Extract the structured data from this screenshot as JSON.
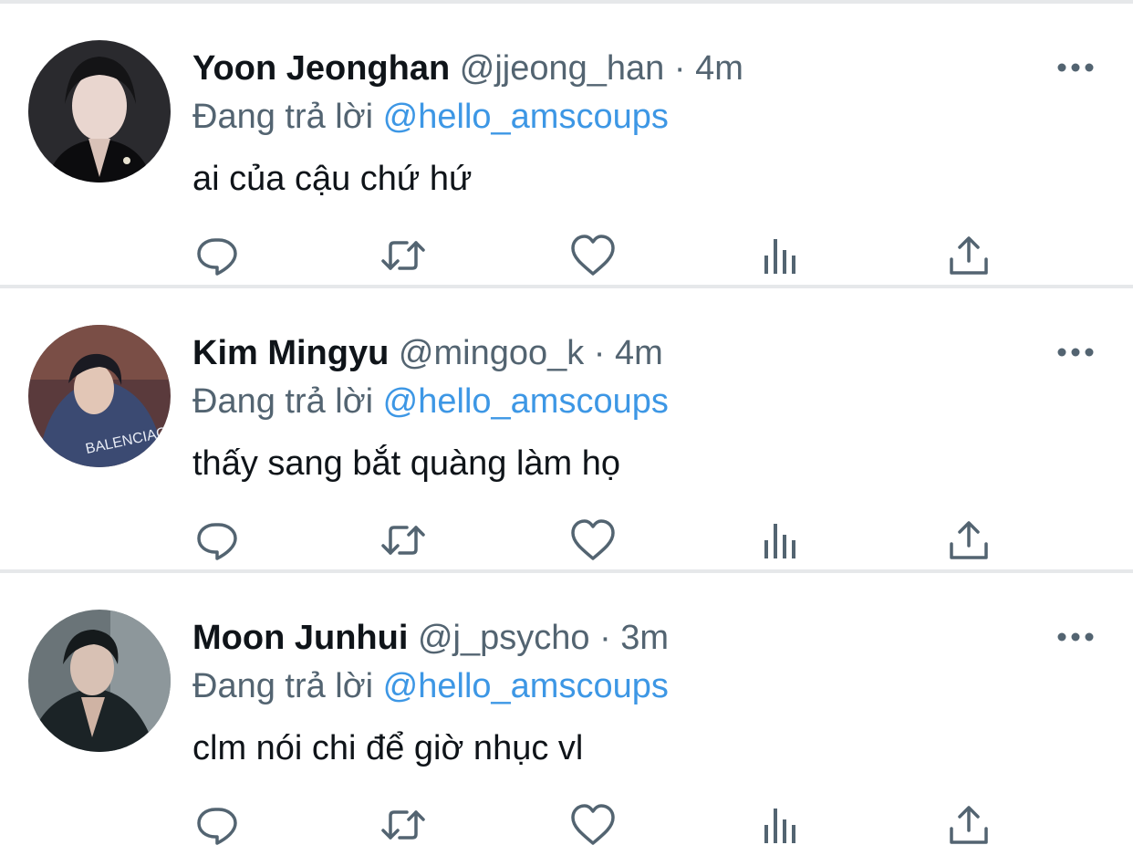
{
  "tweets": [
    {
      "name": "Yoon Jeonghan",
      "handle": "@jjeong_han",
      "separator": "·",
      "time": "4m",
      "reply_prefix": "Đang trả lời",
      "reply_to": "@hello_amscoups",
      "text": "ai của cậu chứ hứ"
    },
    {
      "name": "Kim Mingyu",
      "handle": "@mingoo_k",
      "separator": "·",
      "time": "4m",
      "reply_prefix": "Đang trả lời",
      "reply_to": "@hello_amscoups",
      "text": "thấy sang bắt quàng làm họ"
    },
    {
      "name": "Moon Junhui",
      "handle": "@j_psycho",
      "separator": "·",
      "time": "3m",
      "reply_prefix": "Đang trả lời",
      "reply_to": "@hello_amscoups",
      "text": "clm nói chi để giờ nhục vl"
    }
  ],
  "icons": {
    "more": "more-horizontal-icon",
    "reply": "reply-icon",
    "retweet": "retweet-icon",
    "like": "like-heart-icon",
    "views": "analytics-icon",
    "share": "share-icon"
  },
  "colors": {
    "mention": "#3d97e5",
    "secondary_text": "#536471",
    "primary_text": "#0f1419",
    "divider": "#e6e8ea"
  }
}
